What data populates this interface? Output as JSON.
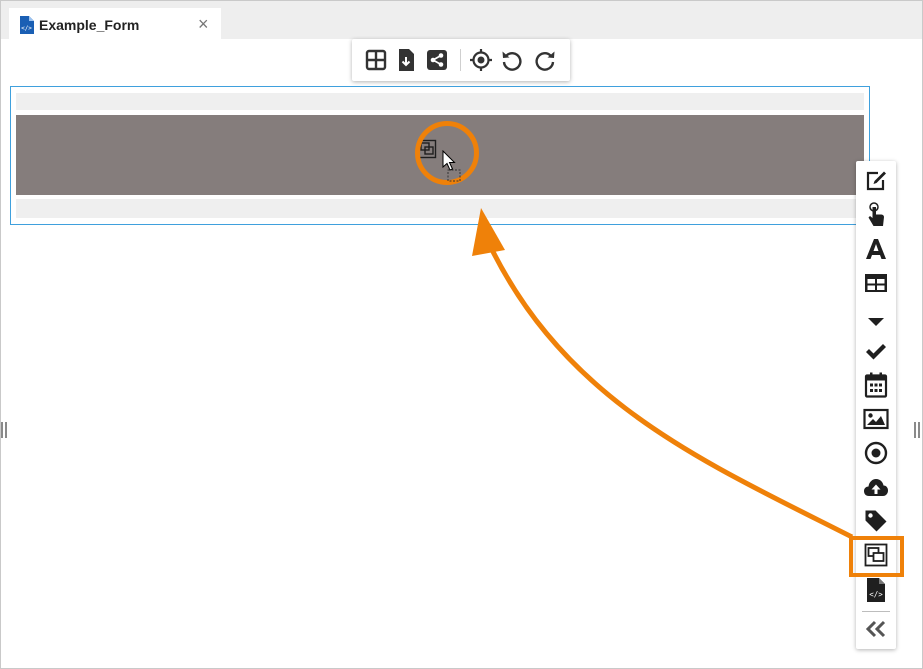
{
  "tab": {
    "title": "Example_Form",
    "close_symbol": "×",
    "icon": "form-file-icon"
  },
  "toolbar": {
    "icons": [
      "grid-layout-icon",
      "export-file-icon",
      "share-icon",
      "target-icon",
      "undo-icon",
      "redo-icon"
    ]
  },
  "palette": {
    "icons": [
      "edit-icon",
      "touch-icon",
      "text-icon",
      "table-icon",
      "dropdown-icon",
      "checkbox-icon",
      "calendar-icon",
      "image-icon",
      "radio-icon",
      "upload-icon",
      "tag-icon",
      "subform-icon",
      "code-file-icon",
      "collapse-icon"
    ],
    "highlighted": "subform-icon"
  },
  "colors": {
    "accent": "#ef8109",
    "selection_border": "#3fa0dd",
    "dropzone": "#857d7c",
    "icon": "#1f1f1f",
    "file_icon": "#1a5fb4"
  }
}
